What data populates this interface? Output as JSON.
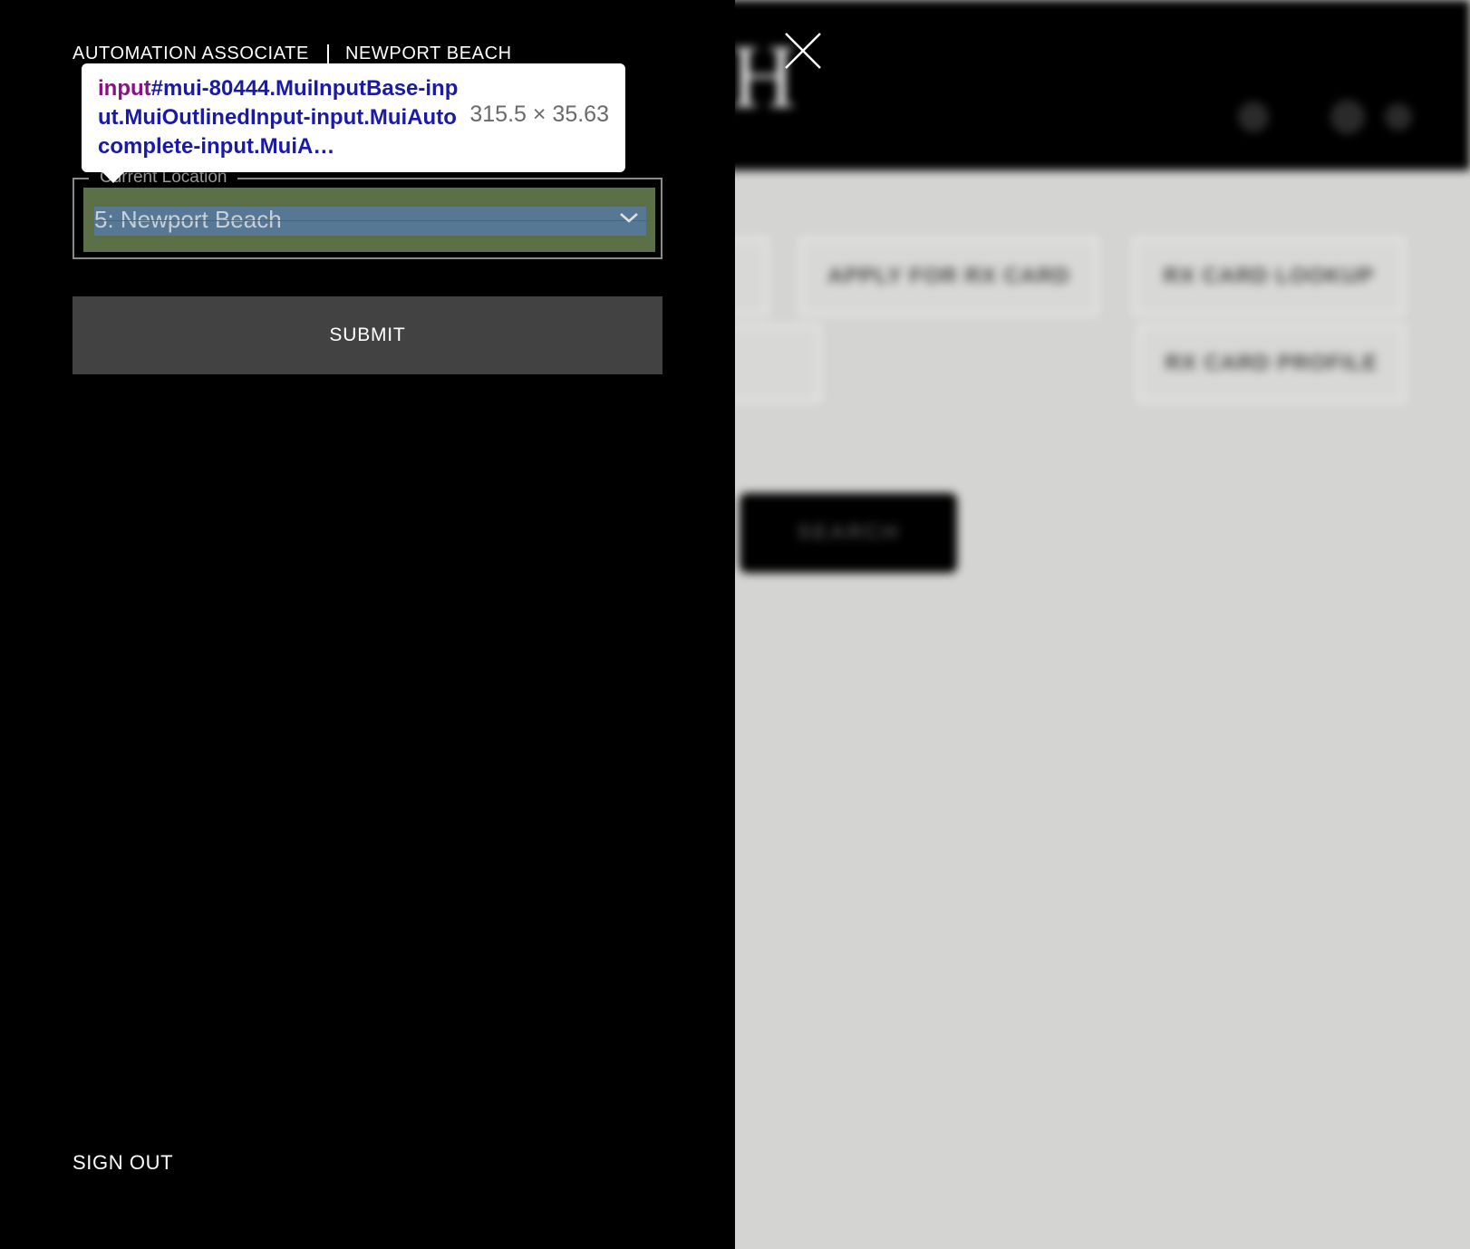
{
  "header": {
    "role": "AUTOMATION ASSOCIATE",
    "location": "NEWPORT BEACH"
  },
  "location_field": {
    "legend": "Current Location",
    "value": "5: Newport Beach"
  },
  "submit_label": "SUBMIT",
  "sign_out_label": "SIGN OUT",
  "inspector": {
    "tag": "input",
    "selector": "#mui-80444.MuiInputBase-input.MuiOutlinedInput-input.MuiAutocomplete-input.MuiA…",
    "dimensions": "315.5 × 35.63"
  },
  "background": {
    "tiles": [
      "",
      "APPLY FOR RX CARD",
      "RX CARD LOOKUP",
      "",
      "RX CARD PROFILE"
    ],
    "search_label": "SEARCH"
  },
  "colors": {
    "drawer": "#000000",
    "submit": "#424242",
    "background": "#d4d4d2",
    "highlight_margin": "#5c7048",
    "highlight_content": "#567894",
    "inspector_tag": "#881280",
    "inspector_selector": "#1a1aa6"
  },
  "icons": {
    "close": "close-icon",
    "dropdown": "chevron-down-icon"
  }
}
